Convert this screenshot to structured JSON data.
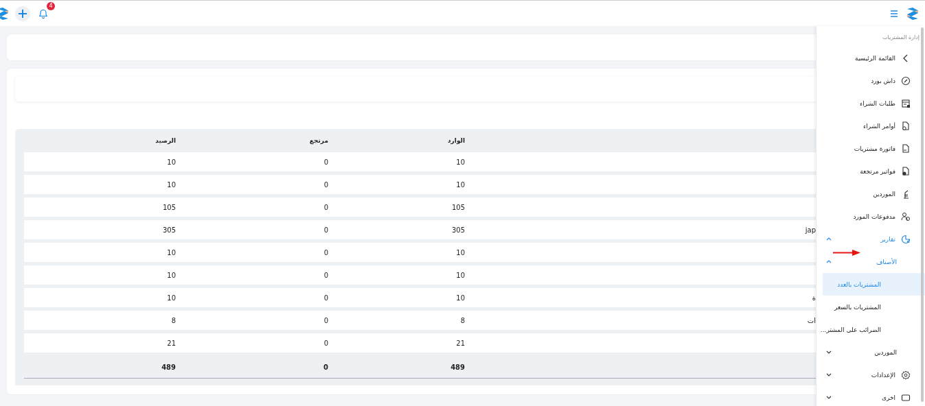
{
  "topbar": {
    "notification_count": "4"
  },
  "sidebar": {
    "section_title": "إدارة المشتريات",
    "items": [
      {
        "label": "القائمة الرئيسية",
        "kind": "back"
      },
      {
        "label": "داش بورد",
        "kind": "link"
      },
      {
        "label": "طلبات الشراء",
        "kind": "link"
      },
      {
        "label": "أوامر الشراء",
        "kind": "link"
      },
      {
        "label": "فاتورة مشتريات",
        "kind": "link"
      },
      {
        "label": "فواتير مرتجعة",
        "kind": "link"
      },
      {
        "label": "الموردين",
        "kind": "link"
      },
      {
        "label": "مدفوعات المورد",
        "kind": "link"
      },
      {
        "label": "تقارير",
        "kind": "group",
        "active": true,
        "expanded": true,
        "children": [
          {
            "label": "الأصناف",
            "kind": "subgroup",
            "active": true,
            "expanded": true,
            "children": [
              {
                "label": "المشتريات بالعدد",
                "kind": "subitem",
                "selected": true
              },
              {
                "label": "المشتريات بالسعر",
                "kind": "subitem",
                "selected": false
              },
              {
                "label": "الضرائب على المشتر...",
                "kind": "subitem",
                "selected": false
              }
            ]
          },
          {
            "label": "الموردين",
            "kind": "subgroup",
            "active": false,
            "expanded": false
          }
        ]
      },
      {
        "label": "الإعدادات",
        "kind": "group",
        "active": false,
        "expanded": false
      },
      {
        "label": "اخرى",
        "kind": "group",
        "active": false,
        "expanded": false
      }
    ]
  },
  "annotations": [
    {
      "kind": "arrow"
    }
  ],
  "table": {
    "columns": [
      "الوارد",
      "مرتجع",
      "الرصيد"
    ],
    "rows": [
      {
        "balance": "10",
        "returned": "0",
        "incoming": "10"
      },
      {
        "balance": "10",
        "returned": "0",
        "incoming": "10"
      },
      {
        "balance": "105",
        "returned": "0",
        "incoming": "105"
      },
      {
        "balance": "305",
        "returned": "0",
        "incoming": "305",
        "column_4": "jap"
      },
      {
        "balance": "10",
        "returned": "0",
        "incoming": "10"
      },
      {
        "balance": "10",
        "returned": "0",
        "incoming": "10"
      },
      {
        "balance": "10",
        "returned": "0",
        "incoming": "10",
        "column_4": "ة"
      },
      {
        "balance": "8",
        "returned": "0",
        "incoming": "8",
        "column_4": "ات"
      },
      {
        "balance": "21",
        "returned": "0",
        "incoming": "21"
      }
    ],
    "totals": {
      "balance": "489",
      "returned": "0",
      "incoming": "489"
    }
  }
}
